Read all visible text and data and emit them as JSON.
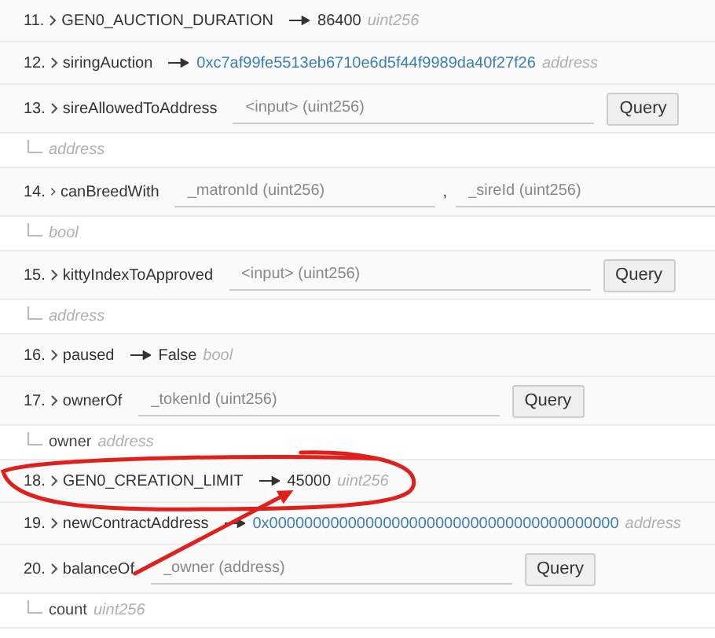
{
  "functions": [
    {
      "kind": "constant",
      "number": "11.",
      "name": "GEN0_AUCTION_DURATION",
      "value": "86400",
      "value_link": false,
      "type": "uint256"
    },
    {
      "kind": "constant",
      "number": "12.",
      "name": "siringAuction",
      "value": "0xc7af99fe5513eb6710e6d5f44f9989da40f27f26",
      "value_link": true,
      "type": "address"
    },
    {
      "kind": "query",
      "number": "13.",
      "name": "sireAllowedToAddress",
      "inputs": [
        {
          "placeholder": "<input> (uint256)"
        }
      ],
      "button": "Query",
      "outputs": [
        {
          "type": "address"
        }
      ]
    },
    {
      "kind": "query",
      "number": "14.",
      "name": "canBreedWith",
      "inputs": [
        {
          "placeholder": "_matronId (uint256)"
        },
        {
          "placeholder": "_sireId (uint256)"
        }
      ],
      "separator": ",",
      "outputs": [
        {
          "type": "bool"
        }
      ]
    },
    {
      "kind": "query",
      "number": "15.",
      "name": "kittyIndexToApproved",
      "inputs": [
        {
          "placeholder": "<input> (uint256)"
        }
      ],
      "button": "Query",
      "outputs": [
        {
          "type": "address"
        }
      ]
    },
    {
      "kind": "constant",
      "number": "16.",
      "name": "paused",
      "value": "False",
      "value_link": false,
      "type": "bool"
    },
    {
      "kind": "query",
      "number": "17.",
      "name": "ownerOf",
      "inputs": [
        {
          "placeholder": "_tokenId (uint256)"
        }
      ],
      "button": "Query",
      "outputs": [
        {
          "name": "owner",
          "type": "address"
        }
      ]
    },
    {
      "kind": "constant",
      "number": "18.",
      "name": "GEN0_CREATION_LIMIT",
      "value": "45000",
      "value_link": false,
      "type": "uint256",
      "circled": true
    },
    {
      "kind": "constant",
      "number": "19.",
      "name": "newContractAddress",
      "value": "0x0000000000000000000000000000000000000000",
      "value_link": true,
      "type": "address"
    },
    {
      "kind": "query",
      "number": "20.",
      "name": "balanceOf",
      "inputs": [
        {
          "placeholder": "_owner (address)"
        }
      ],
      "button": "Query",
      "outputs": [
        {
          "name": "count",
          "type": "uint256"
        }
      ],
      "arrow_start": true
    }
  ]
}
